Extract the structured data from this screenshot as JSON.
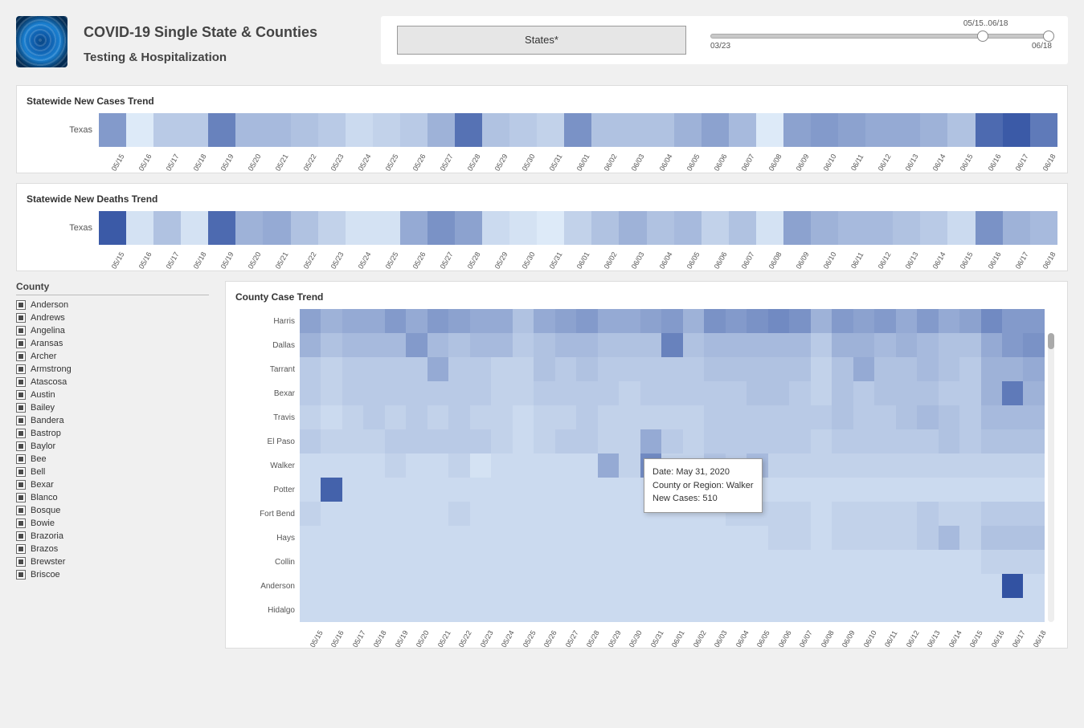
{
  "header": {
    "title": "COVID-19 Single State & Counties",
    "subtitle": "Testing & Hospitalization",
    "state_select_label": "States*",
    "slider": {
      "range_label": "05/15..06/18",
      "min_label": "03/23",
      "max_label": "06/18"
    }
  },
  "dates": [
    "05/15",
    "05/16",
    "05/17",
    "05/18",
    "05/19",
    "05/20",
    "05/21",
    "05/22",
    "05/23",
    "05/24",
    "05/25",
    "05/26",
    "05/27",
    "05/28",
    "05/29",
    "05/30",
    "05/31",
    "06/01",
    "06/02",
    "06/03",
    "06/04",
    "06/05",
    "06/06",
    "06/07",
    "06/08",
    "06/09",
    "06/10",
    "06/11",
    "06/12",
    "06/13",
    "06/14",
    "06/15",
    "06/16",
    "06/17",
    "06/18"
  ],
  "cases_panel": {
    "title": "Statewide New Cases Trend",
    "row_label": "Texas"
  },
  "deaths_panel": {
    "title": "Statewide New Deaths Trend",
    "row_label": "Texas"
  },
  "county_filter": {
    "title": "County",
    "items": [
      "Anderson",
      "Andrews",
      "Angelina",
      "Aransas",
      "Archer",
      "Armstrong",
      "Atascosa",
      "Austin",
      "Bailey",
      "Bandera",
      "Bastrop",
      "Baylor",
      "Bee",
      "Bell",
      "Bexar",
      "Blanco",
      "Bosque",
      "Bowie",
      "Brazoria",
      "Brazos",
      "Brewster",
      "Briscoe"
    ]
  },
  "county_panel": {
    "title": "County Case Trend",
    "rows": [
      "Harris",
      "Dallas",
      "Tarrant",
      "Bexar",
      "Travis",
      "El Paso",
      "Walker",
      "Potter",
      "Fort Bend",
      "Hays",
      "Collin",
      "Anderson",
      "Hidalgo"
    ]
  },
  "tooltip": {
    "line1": "Date: May 31, 2020",
    "line2": "County or Region: Walker",
    "line3": "New Cases:  510"
  },
  "chart_data": [
    {
      "type": "heatmap",
      "title": "Statewide New Cases Trend",
      "y": [
        "Texas"
      ],
      "x": [
        "05/15",
        "05/16",
        "05/17",
        "05/18",
        "05/19",
        "05/20",
        "05/21",
        "05/22",
        "05/23",
        "05/24",
        "05/25",
        "05/26",
        "05/27",
        "05/28",
        "05/29",
        "05/30",
        "05/31",
        "06/01",
        "06/02",
        "06/03",
        "06/04",
        "06/05",
        "06/06",
        "06/07",
        "06/08",
        "06/09",
        "06/10",
        "06/11",
        "06/12",
        "06/13",
        "06/14",
        "06/15",
        "06/16",
        "06/17",
        "06/18"
      ],
      "values": [
        [
          55,
          5,
          25,
          25,
          70,
          35,
          35,
          30,
          25,
          15,
          20,
          25,
          40,
          80,
          30,
          25,
          20,
          60,
          30,
          30,
          30,
          40,
          50,
          35,
          5,
          50,
          55,
          50,
          45,
          45,
          40,
          30,
          85,
          95,
          75
        ]
      ],
      "color_scale": "blues",
      "note": "Values are relative intensities (darker = higher count). Exact counts not labeled on chart."
    },
    {
      "type": "heatmap",
      "title": "Statewide New Deaths Trend",
      "y": [
        "Texas"
      ],
      "x": [
        "05/15",
        "05/16",
        "05/17",
        "05/18",
        "05/19",
        "05/20",
        "05/21",
        "05/22",
        "05/23",
        "05/24",
        "05/25",
        "05/26",
        "05/27",
        "05/28",
        "05/29",
        "05/30",
        "05/31",
        "06/01",
        "06/02",
        "06/03",
        "06/04",
        "06/05",
        "06/06",
        "06/07",
        "06/08",
        "06/09",
        "06/10",
        "06/11",
        "06/12",
        "06/13",
        "06/14",
        "06/15",
        "06/16",
        "06/17",
        "06/18"
      ],
      "values": [
        [
          95,
          10,
          30,
          10,
          85,
          40,
          45,
          30,
          20,
          10,
          10,
          45,
          60,
          50,
          15,
          10,
          5,
          20,
          30,
          40,
          30,
          35,
          20,
          30,
          10,
          50,
          40,
          35,
          35,
          30,
          25,
          15,
          60,
          40,
          35
        ]
      ],
      "color_scale": "blues",
      "note": "Values are relative intensities (darker = higher count). Exact counts not labeled on chart."
    },
    {
      "type": "heatmap",
      "title": "County Case Trend",
      "y": [
        "Harris",
        "Dallas",
        "Tarrant",
        "Bexar",
        "Travis",
        "El Paso",
        "Walker",
        "Potter",
        "Fort Bend",
        "Hays",
        "Collin",
        "Anderson",
        "Hidalgo"
      ],
      "x": [
        "05/15",
        "05/16",
        "05/17",
        "05/18",
        "05/19",
        "05/20",
        "05/21",
        "05/22",
        "05/23",
        "05/24",
        "05/25",
        "05/26",
        "05/27",
        "05/28",
        "05/29",
        "05/30",
        "05/31",
        "06/01",
        "06/02",
        "06/03",
        "06/04",
        "06/05",
        "06/06",
        "06/07",
        "06/08",
        "06/09",
        "06/10",
        "06/11",
        "06/12",
        "06/13",
        "06/14",
        "06/15",
        "06/16",
        "06/17",
        "06/18"
      ],
      "values": [
        [
          50,
          40,
          45,
          45,
          55,
          45,
          55,
          50,
          45,
          45,
          30,
          45,
          50,
          55,
          45,
          45,
          50,
          55,
          40,
          60,
          55,
          60,
          65,
          60,
          40,
          55,
          50,
          55,
          45,
          55,
          45,
          50,
          65,
          55,
          55
        ],
        [
          40,
          30,
          35,
          35,
          35,
          55,
          35,
          30,
          35,
          35,
          25,
          30,
          35,
          35,
          30,
          30,
          30,
          70,
          30,
          35,
          35,
          35,
          35,
          35,
          25,
          40,
          40,
          35,
          40,
          35,
          30,
          30,
          45,
          55,
          60
        ],
        [
          25,
          20,
          25,
          25,
          25,
          25,
          45,
          25,
          25,
          20,
          20,
          30,
          25,
          30,
          25,
          25,
          25,
          25,
          25,
          30,
          30,
          30,
          30,
          30,
          20,
          30,
          45,
          30,
          30,
          35,
          30,
          25,
          40,
          40,
          45
        ],
        [
          25,
          20,
          25,
          25,
          25,
          25,
          25,
          25,
          25,
          20,
          20,
          25,
          25,
          25,
          25,
          20,
          25,
          25,
          25,
          25,
          25,
          30,
          30,
          25,
          20,
          30,
          25,
          30,
          30,
          30,
          25,
          25,
          40,
          75,
          40
        ],
        [
          20,
          15,
          20,
          25,
          20,
          25,
          20,
          25,
          20,
          20,
          15,
          20,
          20,
          25,
          20,
          20,
          20,
          20,
          20,
          25,
          25,
          25,
          25,
          25,
          25,
          30,
          25,
          25,
          30,
          35,
          30,
          25,
          35,
          35,
          35
        ],
        [
          25,
          20,
          20,
          20,
          25,
          25,
          25,
          25,
          25,
          20,
          15,
          20,
          25,
          25,
          20,
          20,
          45,
          25,
          20,
          25,
          25,
          25,
          25,
          25,
          20,
          25,
          25,
          25,
          25,
          25,
          30,
          25,
          30,
          30,
          30
        ],
        [
          15,
          15,
          15,
          15,
          20,
          15,
          15,
          20,
          10,
          15,
          15,
          15,
          15,
          15,
          45,
          20,
          510,
          20,
          20,
          30,
          25,
          35,
          20,
          20,
          20,
          20,
          20,
          20,
          20,
          20,
          20,
          20,
          20,
          20,
          20
        ],
        [
          15,
          90,
          15,
          15,
          15,
          15,
          15,
          15,
          15,
          15,
          15,
          15,
          15,
          15,
          15,
          15,
          15,
          15,
          15,
          15,
          15,
          15,
          15,
          15,
          15,
          15,
          15,
          15,
          15,
          15,
          15,
          15,
          15,
          15,
          15
        ],
        [
          20,
          15,
          15,
          15,
          15,
          15,
          15,
          20,
          15,
          15,
          15,
          15,
          15,
          15,
          15,
          15,
          15,
          15,
          15,
          15,
          20,
          20,
          20,
          20,
          15,
          20,
          20,
          20,
          20,
          25,
          20,
          20,
          25,
          25,
          25
        ],
        [
          15,
          15,
          15,
          15,
          15,
          15,
          15,
          15,
          15,
          15,
          15,
          15,
          15,
          15,
          15,
          15,
          15,
          15,
          15,
          15,
          15,
          15,
          20,
          20,
          15,
          20,
          20,
          20,
          20,
          25,
          35,
          20,
          30,
          30,
          30
        ],
        [
          15,
          15,
          15,
          15,
          15,
          15,
          15,
          15,
          15,
          15,
          15,
          15,
          15,
          15,
          15,
          15,
          15,
          15,
          15,
          15,
          15,
          15,
          15,
          15,
          15,
          15,
          15,
          15,
          15,
          15,
          15,
          15,
          20,
          20,
          20
        ],
        [
          15,
          15,
          15,
          15,
          15,
          15,
          15,
          15,
          15,
          15,
          15,
          15,
          15,
          15,
          15,
          15,
          15,
          15,
          15,
          15,
          15,
          15,
          15,
          15,
          15,
          15,
          15,
          15,
          15,
          15,
          15,
          15,
          15,
          100,
          15
        ],
        [
          15,
          15,
          15,
          15,
          15,
          15,
          15,
          15,
          15,
          15,
          15,
          15,
          15,
          15,
          15,
          15,
          15,
          15,
          15,
          15,
          15,
          15,
          15,
          15,
          15,
          15,
          15,
          15,
          15,
          15,
          15,
          15,
          15,
          15,
          15
        ]
      ],
      "color_scale": "blues",
      "tooltip_example": {
        "date": "May 31, 2020",
        "county": "Walker",
        "new_cases": 510
      },
      "note": "Values are relative intensities except Walker 05/31 = 510 from tooltip. Darker = higher."
    }
  ]
}
